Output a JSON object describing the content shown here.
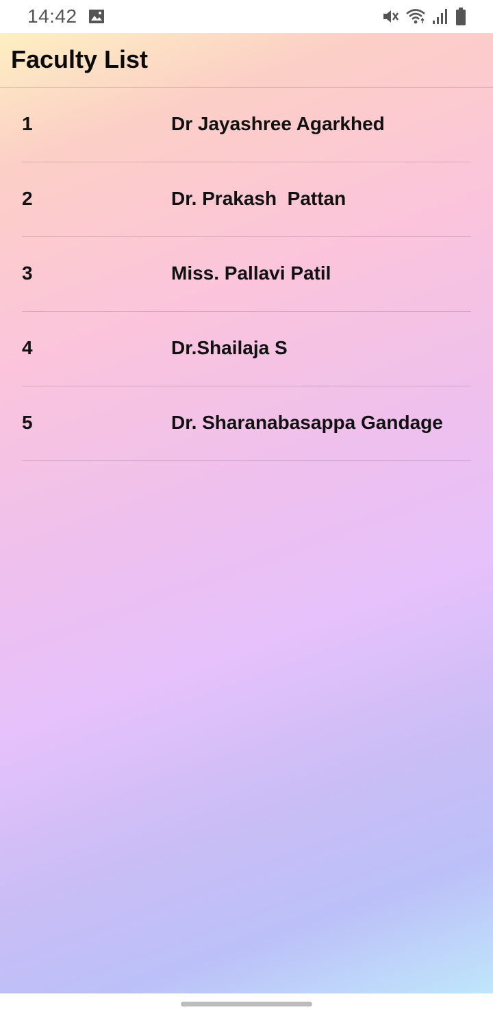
{
  "status_bar": {
    "time": "14:42",
    "icons": [
      "gallery-icon",
      "mute-icon",
      "wifi-icon",
      "signal-icon",
      "battery-icon"
    ]
  },
  "app": {
    "title": "Faculty List",
    "background_colors": [
      "#fdf0c2",
      "#fbc4dc",
      "#e6c1fb",
      "#bcc0f8",
      "#bfe6fb"
    ]
  },
  "faculty": [
    {
      "number": "1",
      "name": "Dr Jayashree Agarkhed"
    },
    {
      "number": "2",
      "name": "Dr. Prakash  Pattan"
    },
    {
      "number": "3",
      "name": "Miss. Pallavi Patil"
    },
    {
      "number": "4",
      "name": "Dr.Shailaja S"
    },
    {
      "number": "5",
      "name": "Dr. Sharanabasappa Gandage"
    }
  ]
}
